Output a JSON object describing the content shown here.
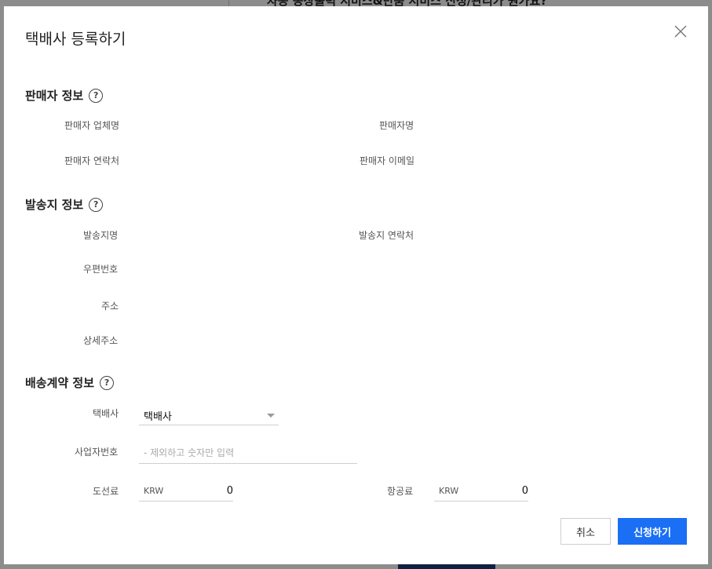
{
  "background": {
    "heading": "자동 송장출력 서비스&반품 서비스 신청/관리가 뭔가요?"
  },
  "modal": {
    "title": "택배사 등록하기"
  },
  "seller_section": {
    "title": "판매자 정보",
    "fields": {
      "company_name": "판매자 업체명",
      "seller_name": "판매자명",
      "contact": "판매자 연락처",
      "email": "판매자 이메일"
    }
  },
  "sender_section": {
    "title": "발송지 정보",
    "fields": {
      "location_name": "발송지명",
      "location_contact": "발송지 연락처",
      "postal_code": "우편번호",
      "address": "주소",
      "detail_address": "상세주소"
    }
  },
  "contract_section": {
    "title": "배송계약 정보",
    "courier_label": "택배사",
    "courier_value": "택배사",
    "business_number_label": "사업자번호",
    "business_number_placeholder": "- 제외하고 숫자만 입력",
    "island_fee_label": "도선료",
    "island_fee_unit": "KRW",
    "island_fee_value": "0",
    "air_fee_label": "항공료",
    "air_fee_unit": "KRW",
    "air_fee_value": "0"
  },
  "actions": {
    "cancel_label": "취소",
    "submit_label": "신청하기"
  },
  "colors": {
    "primary": "#1a6ff5",
    "overlay": "#000000"
  }
}
